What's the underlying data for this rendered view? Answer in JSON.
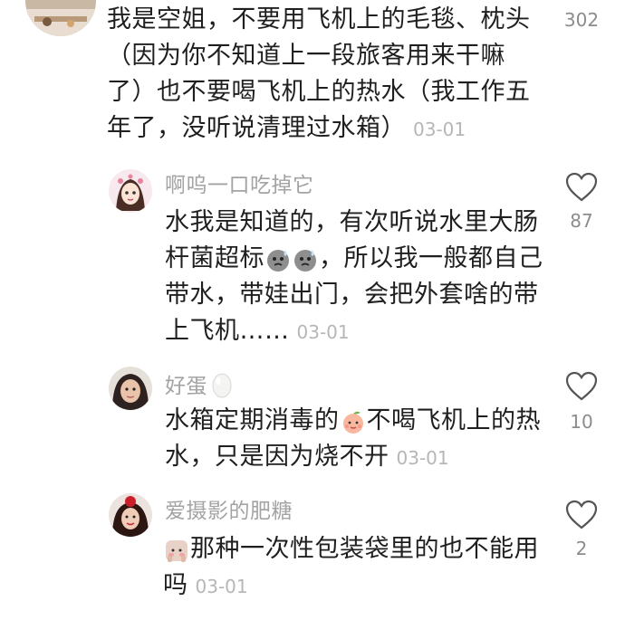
{
  "main_comment": {
    "text_lines": [
      "我是空姐，不要用飞机上的毛毯、枕头",
      "（因为你不知道上一段旅客用来干嘛",
      "了）也不要喝飞机上的热水（我工作五",
      "年了，没听说清理过水箱）"
    ],
    "date": "03-01",
    "like_count": "302"
  },
  "replies": [
    {
      "author": "啊呜一口吃掉它",
      "text_lines": [
        "水我是知道的，有次听说水里大肠",
        "杆菌超标",
        "，所以我一般都自己",
        "带水，带娃出门，会把外套啥的带",
        "上飞机……"
      ],
      "date": "03-01",
      "like_count": "87"
    },
    {
      "author": "好蛋",
      "text_lines": [
        "水箱定期消毒的",
        "不喝飞机上的热",
        "水，只是因为烧不开"
      ],
      "date": "03-01",
      "like_count": "10"
    },
    {
      "author": "爱摄影的肥糖",
      "text_lines": [
        "那种一次性包装袋里的也不能用",
        "吗"
      ],
      "date": "03-01",
      "like_count": "2"
    }
  ],
  "icons": {
    "like": "heart-outline-icon",
    "emoji_sweat": "sweat-face-emoji",
    "emoji_peach": "peach-face-emoji",
    "emoji_shy": "shy-face-emoji",
    "emoji_egg": "egg-emoji"
  },
  "colors": {
    "text": "#1f1f1f",
    "author": "#a3a3a3",
    "date": "#b6b6b6",
    "like_count": "#8c8c8c",
    "heart_stroke": "#555555"
  }
}
